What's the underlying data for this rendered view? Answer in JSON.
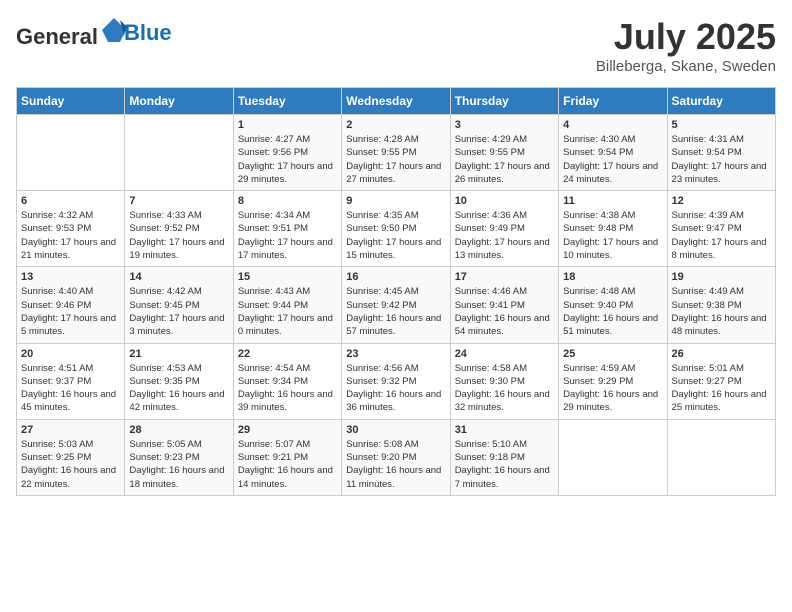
{
  "header": {
    "logo_line1": "General",
    "logo_line2": "Blue",
    "month": "July 2025",
    "location": "Billeberga, Skane, Sweden"
  },
  "weekdays": [
    "Sunday",
    "Monday",
    "Tuesday",
    "Wednesday",
    "Thursday",
    "Friday",
    "Saturday"
  ],
  "weeks": [
    [
      {
        "day": "",
        "info": ""
      },
      {
        "day": "",
        "info": ""
      },
      {
        "day": "1",
        "sunrise": "4:27 AM",
        "sunset": "9:56 PM",
        "daylight": "17 hours and 29 minutes."
      },
      {
        "day": "2",
        "sunrise": "4:28 AM",
        "sunset": "9:55 PM",
        "daylight": "17 hours and 27 minutes."
      },
      {
        "day": "3",
        "sunrise": "4:29 AM",
        "sunset": "9:55 PM",
        "daylight": "17 hours and 26 minutes."
      },
      {
        "day": "4",
        "sunrise": "4:30 AM",
        "sunset": "9:54 PM",
        "daylight": "17 hours and 24 minutes."
      },
      {
        "day": "5",
        "sunrise": "4:31 AM",
        "sunset": "9:54 PM",
        "daylight": "17 hours and 23 minutes."
      }
    ],
    [
      {
        "day": "6",
        "sunrise": "4:32 AM",
        "sunset": "9:53 PM",
        "daylight": "17 hours and 21 minutes."
      },
      {
        "day": "7",
        "sunrise": "4:33 AM",
        "sunset": "9:52 PM",
        "daylight": "17 hours and 19 minutes."
      },
      {
        "day": "8",
        "sunrise": "4:34 AM",
        "sunset": "9:51 PM",
        "daylight": "17 hours and 17 minutes."
      },
      {
        "day": "9",
        "sunrise": "4:35 AM",
        "sunset": "9:50 PM",
        "daylight": "17 hours and 15 minutes."
      },
      {
        "day": "10",
        "sunrise": "4:36 AM",
        "sunset": "9:49 PM",
        "daylight": "17 hours and 13 minutes."
      },
      {
        "day": "11",
        "sunrise": "4:38 AM",
        "sunset": "9:48 PM",
        "daylight": "17 hours and 10 minutes."
      },
      {
        "day": "12",
        "sunrise": "4:39 AM",
        "sunset": "9:47 PM",
        "daylight": "17 hours and 8 minutes."
      }
    ],
    [
      {
        "day": "13",
        "sunrise": "4:40 AM",
        "sunset": "9:46 PM",
        "daylight": "17 hours and 5 minutes."
      },
      {
        "day": "14",
        "sunrise": "4:42 AM",
        "sunset": "9:45 PM",
        "daylight": "17 hours and 3 minutes."
      },
      {
        "day": "15",
        "sunrise": "4:43 AM",
        "sunset": "9:44 PM",
        "daylight": "17 hours and 0 minutes."
      },
      {
        "day": "16",
        "sunrise": "4:45 AM",
        "sunset": "9:42 PM",
        "daylight": "16 hours and 57 minutes."
      },
      {
        "day": "17",
        "sunrise": "4:46 AM",
        "sunset": "9:41 PM",
        "daylight": "16 hours and 54 minutes."
      },
      {
        "day": "18",
        "sunrise": "4:48 AM",
        "sunset": "9:40 PM",
        "daylight": "16 hours and 51 minutes."
      },
      {
        "day": "19",
        "sunrise": "4:49 AM",
        "sunset": "9:38 PM",
        "daylight": "16 hours and 48 minutes."
      }
    ],
    [
      {
        "day": "20",
        "sunrise": "4:51 AM",
        "sunset": "9:37 PM",
        "daylight": "16 hours and 45 minutes."
      },
      {
        "day": "21",
        "sunrise": "4:53 AM",
        "sunset": "9:35 PM",
        "daylight": "16 hours and 42 minutes."
      },
      {
        "day": "22",
        "sunrise": "4:54 AM",
        "sunset": "9:34 PM",
        "daylight": "16 hours and 39 minutes."
      },
      {
        "day": "23",
        "sunrise": "4:56 AM",
        "sunset": "9:32 PM",
        "daylight": "16 hours and 36 minutes."
      },
      {
        "day": "24",
        "sunrise": "4:58 AM",
        "sunset": "9:30 PM",
        "daylight": "16 hours and 32 minutes."
      },
      {
        "day": "25",
        "sunrise": "4:59 AM",
        "sunset": "9:29 PM",
        "daylight": "16 hours and 29 minutes."
      },
      {
        "day": "26",
        "sunrise": "5:01 AM",
        "sunset": "9:27 PM",
        "daylight": "16 hours and 25 minutes."
      }
    ],
    [
      {
        "day": "27",
        "sunrise": "5:03 AM",
        "sunset": "9:25 PM",
        "daylight": "16 hours and 22 minutes."
      },
      {
        "day": "28",
        "sunrise": "5:05 AM",
        "sunset": "9:23 PM",
        "daylight": "16 hours and 18 minutes."
      },
      {
        "day": "29",
        "sunrise": "5:07 AM",
        "sunset": "9:21 PM",
        "daylight": "16 hours and 14 minutes."
      },
      {
        "day": "30",
        "sunrise": "5:08 AM",
        "sunset": "9:20 PM",
        "daylight": "16 hours and 11 minutes."
      },
      {
        "day": "31",
        "sunrise": "5:10 AM",
        "sunset": "9:18 PM",
        "daylight": "16 hours and 7 minutes."
      },
      {
        "day": "",
        "info": ""
      },
      {
        "day": "",
        "info": ""
      }
    ]
  ]
}
